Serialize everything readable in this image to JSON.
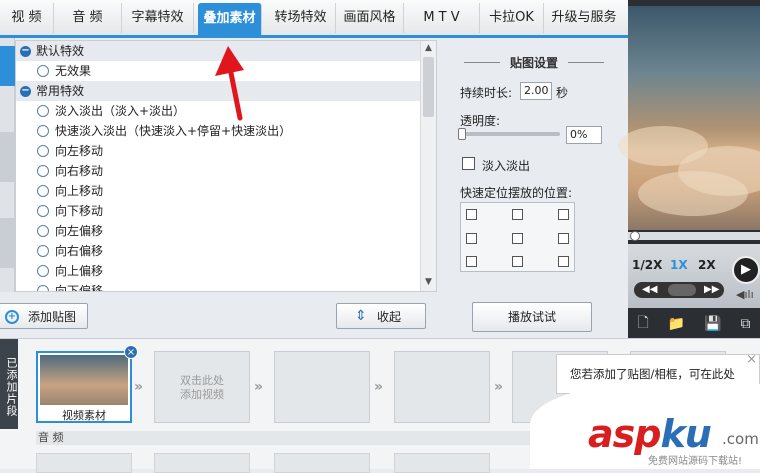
{
  "tabs": [
    {
      "label": "视 频",
      "active": false
    },
    {
      "label": "音 频",
      "active": false
    },
    {
      "label": "字幕特效",
      "active": false
    },
    {
      "label": "叠加素材",
      "active": true
    },
    {
      "label": "转场特效",
      "active": false
    },
    {
      "label": "画面风格",
      "active": false
    },
    {
      "label": "M T V",
      "active": false
    },
    {
      "label": "卡拉OK",
      "active": false
    },
    {
      "label": "升级与服务",
      "active": false
    }
  ],
  "effects": {
    "groups": [
      {
        "title": "默认特效",
        "items": [
          "无效果"
        ]
      },
      {
        "title": "常用特效",
        "items": [
          "淡入淡出（淡入+淡出）",
          "快速淡入淡出（快速淡入+停留+快速淡出）",
          "向左移动",
          "向右移动",
          "向上移动",
          "向下移动",
          "向左偏移",
          "向右偏移",
          "向上偏移",
          "向下偏移"
        ]
      }
    ]
  },
  "left_bottom": {
    "add_label": "添加贴图",
    "collapse_label": "收起"
  },
  "settings": {
    "title": "贴图设置",
    "duration_label": "持续时长:",
    "duration_value": "2.00",
    "duration_unit": "秒",
    "opacity_label": "透明度:",
    "opacity_value": "0%",
    "opacity_fraction": 0.0,
    "fade_label": "淡入淡出",
    "fade_checked": false,
    "position_label": "快速定位摆放的位置:",
    "play_label": "播放试试"
  },
  "player": {
    "speeds": [
      "1/2X",
      "1X",
      "2X"
    ],
    "active_speed": "1X",
    "progress_fraction": 0.0
  },
  "timeline": {
    "label": "已添加片段",
    "first_clip_caption": "视频素材",
    "placeholder_text": "双击此处\n添加视频",
    "audio_label": "音 频"
  },
  "tooltip": {
    "text": "您若添加了贴图/相框，可在此处"
  },
  "watermark": {
    "brand_red": "asp",
    "brand_blue": "ku",
    "suffix": ".com",
    "sub": "免费网站源码下载站!"
  },
  "colors": {
    "accent": "#2d8fd8",
    "arrow": "#e0161c"
  }
}
